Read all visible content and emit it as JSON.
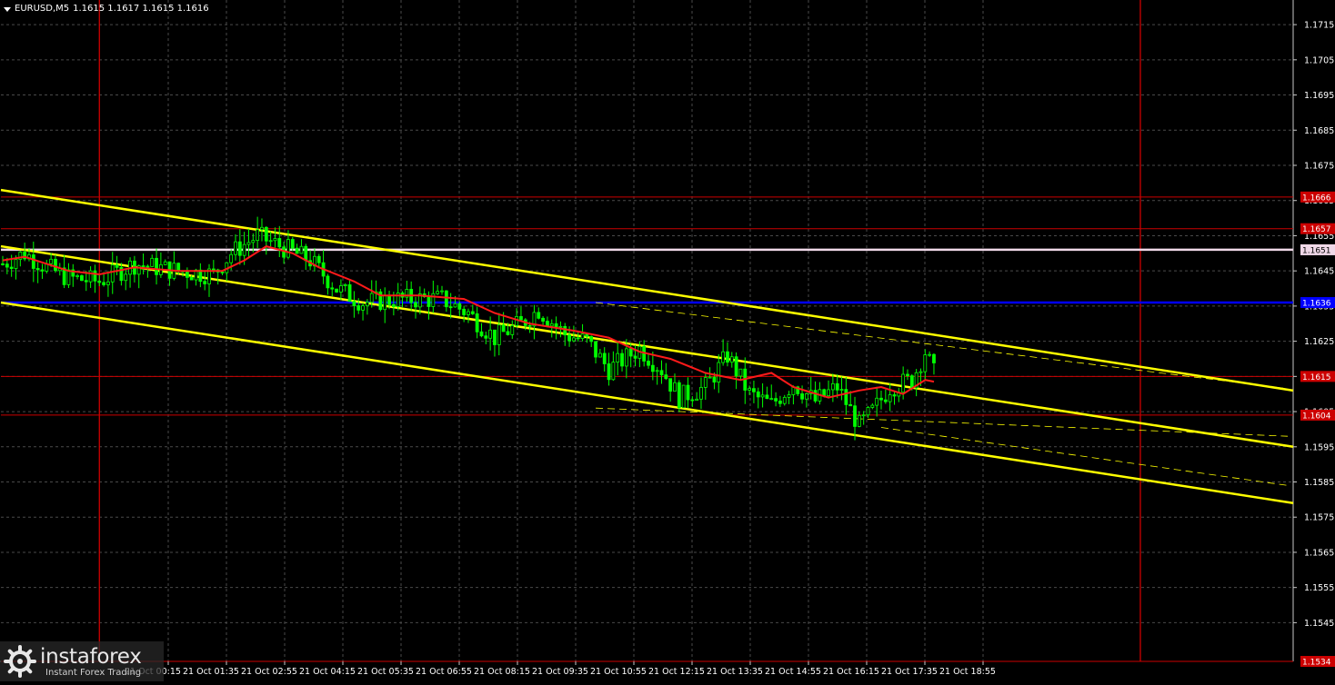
{
  "header": {
    "symbol": "EURUSD,M5",
    "quote": "1.1615 1.1617 1.1615 1.1616"
  },
  "watermark": {
    "brand": "instaforex",
    "tagline": "Instant Forex Trading",
    "icon": "instaforex-gear-logo"
  },
  "colors": {
    "background": "#000000",
    "grid": "#4a4a4a",
    "candle": "#00ff00",
    "moving_average": "#ff1a1a",
    "channel": "#ffff00",
    "support_resistance": "#cc0000",
    "key_level": "#0000ff",
    "highlight_level": "#f0d8e8",
    "session_line": "#dd0000"
  },
  "chart_data": {
    "type": "candlestick",
    "timeframe": "M5",
    "ylim": [
      1.1534,
      1.1722
    ],
    "y_ticks": [
      "1.1715",
      "1.1705",
      "1.1695",
      "1.1685",
      "1.1675",
      "1.1665",
      "1.1655",
      "1.1645",
      "1.1635",
      "1.1625",
      "1.1615",
      "1.1605",
      "1.1595",
      "1.1585",
      "1.1575",
      "1.1565",
      "1.1555",
      "1.1545"
    ],
    "x_ticks": [
      "21 Oct 00:15",
      "21 Oct 01:35",
      "21 Oct 02:55",
      "21 Oct 04:15",
      "21 Oct 05:35",
      "21 Oct 06:55",
      "21 Oct 08:15",
      "21 Oct 09:35",
      "21 Oct 10:55",
      "21 Oct 12:15",
      "21 Oct 13:35",
      "21 Oct 14:55",
      "21 Oct 16:15",
      "21 Oct 17:35",
      "21 Oct 18:55"
    ],
    "horizontal_levels": [
      {
        "label": "1.1666",
        "price": 1.1666,
        "kind": "resistance"
      },
      {
        "label": "1.1657",
        "price": 1.1657,
        "kind": "resistance"
      },
      {
        "label": "1.1651",
        "price": 1.1651,
        "kind": "highlight"
      },
      {
        "label": "1.1636",
        "price": 1.1636,
        "kind": "key"
      },
      {
        "label": "1.1615",
        "price": 1.1615,
        "kind": "resistance"
      },
      {
        "label": "1.1604",
        "price": 1.1604,
        "kind": "resistance"
      },
      {
        "label": "1.1534",
        "price": 1.1534,
        "kind": "resistance"
      }
    ],
    "channel_lines": [
      {
        "name": "upper",
        "start": 1.1668,
        "end": 1.1611
      },
      {
        "name": "middle",
        "start": 1.1652,
        "end": 1.1595
      },
      {
        "name": "lower",
        "start": 1.1636,
        "end": 1.1579
      }
    ],
    "dashed_lines": [
      {
        "start_idx": 135,
        "start": 1.1636,
        "end": 1.16115
      },
      {
        "start_idx": 135,
        "start": 1.1606,
        "end": 1.1598
      },
      {
        "start_idx": 200,
        "start": 1.16005,
        "end": 1.1584
      }
    ],
    "session_lines_idx": [
      22,
      259
    ],
    "ma_path": [
      [
        0,
        1.1648
      ],
      [
        5,
        1.1649
      ],
      [
        10,
        1.1647
      ],
      [
        15,
        1.1645
      ],
      [
        22,
        1.1644
      ],
      [
        30,
        1.1646
      ],
      [
        40,
        1.1645
      ],
      [
        50,
        1.1645
      ],
      [
        55,
        1.1648
      ],
      [
        60,
        1.1652
      ],
      [
        66,
        1.165
      ],
      [
        72,
        1.1646
      ],
      [
        80,
        1.1642
      ],
      [
        86,
        1.1638
      ],
      [
        95,
        1.1638
      ],
      [
        105,
        1.1637
      ],
      [
        112,
        1.1633
      ],
      [
        120,
        1.163
      ],
      [
        130,
        1.1628
      ],
      [
        138,
        1.1626
      ],
      [
        145,
        1.1622
      ],
      [
        152,
        1.162
      ],
      [
        160,
        1.1616
      ],
      [
        168,
        1.1614
      ],
      [
        175,
        1.1616
      ],
      [
        180,
        1.1612
      ],
      [
        188,
        1.1609
      ],
      [
        195,
        1.1611
      ],
      [
        200,
        1.1612
      ],
      [
        205,
        1.161
      ],
      [
        210,
        1.1614
      ],
      [
        212,
        1.16135
      ]
    ],
    "price_path": [
      [
        0,
        1.1647
      ],
      [
        5,
        1.165
      ],
      [
        10,
        1.1646
      ],
      [
        15,
        1.1643
      ],
      [
        22,
        1.1642
      ],
      [
        30,
        1.1647
      ],
      [
        40,
        1.1645
      ],
      [
        48,
        1.1644
      ],
      [
        52,
        1.165
      ],
      [
        58,
        1.1655
      ],
      [
        65,
        1.1651
      ],
      [
        70,
        1.1648
      ],
      [
        76,
        1.164
      ],
      [
        82,
        1.1636
      ],
      [
        90,
        1.1637
      ],
      [
        100,
        1.1637
      ],
      [
        106,
        1.1633
      ],
      [
        112,
        1.1626
      ],
      [
        118,
        1.163
      ],
      [
        122,
        1.1634
      ],
      [
        128,
        1.1627
      ],
      [
        133,
        1.1625
      ],
      [
        138,
        1.1617
      ],
      [
        145,
        1.1623
      ],
      [
        150,
        1.1617
      ],
      [
        154,
        1.1609
      ],
      [
        160,
        1.1612
      ],
      [
        165,
        1.1621
      ],
      [
        170,
        1.161
      ],
      [
        175,
        1.1607
      ],
      [
        180,
        1.1613
      ],
      [
        185,
        1.1608
      ],
      [
        190,
        1.1612
      ],
      [
        195,
        1.1601
      ],
      [
        198,
        1.1605
      ],
      [
        202,
        1.1612
      ],
      [
        207,
        1.1614
      ],
      [
        210,
        1.1622
      ],
      [
        212,
        1.1616
      ]
    ]
  }
}
